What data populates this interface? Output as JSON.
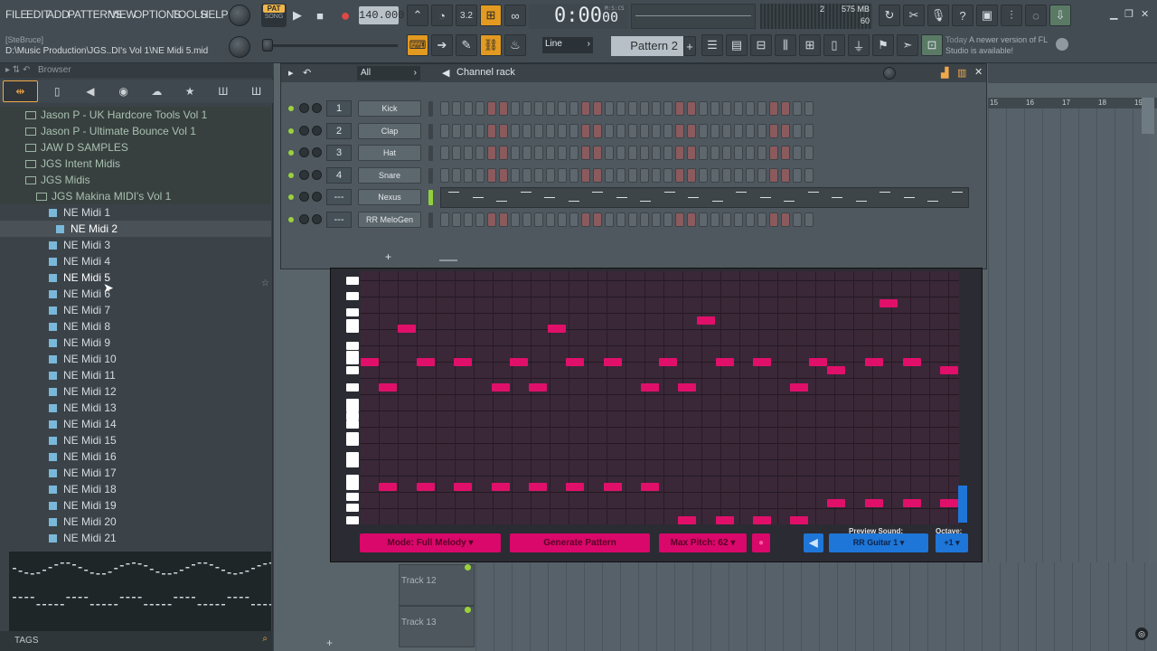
{
  "menu": [
    "FILE",
    "EDIT",
    "ADD",
    "PATTERNS",
    "VIEW",
    "OPTIONS",
    "TOOLS",
    "HELP"
  ],
  "transport": {
    "pat_label": "PAT",
    "song_label": "SONG",
    "tempo": "140.000",
    "time": "0:00",
    "time_frac": "00",
    "time_unit": "M:S:CS",
    "cpu": "575 MB",
    "poly": "60",
    "meter_val": "2"
  },
  "project": {
    "user": "[SteBruce]",
    "path": "D:\\Music Production\\JGS..DI's Vol 1\\NE Midi 5.mid"
  },
  "toolbar": {
    "snap": "Line",
    "pattern": "Pattern 2",
    "hint_day": "Today",
    "hint_text": "A newer version of FL Studio is available!"
  },
  "browser": {
    "title": "Browser",
    "folders": [
      "Jason P - UK Hardcore Tools Vol 1",
      "Jason P - Ultimate Bounce Vol 1",
      "JAW D SAMPLES",
      "JGS Intent Midis",
      "JGS Midis"
    ],
    "subfolder": "JGS Makina MIDI's Vol 1",
    "files": [
      "NE Midi 1",
      "NE Midi 2",
      "NE Midi 3",
      "NE Midi 4",
      "NE Midi 5",
      "NE Midi 6",
      "NE Midi 7",
      "NE Midi 8",
      "NE Midi 9",
      "NE Midi 10",
      "NE Midi 11",
      "NE Midi 12",
      "NE Midi 13",
      "NE Midi 14",
      "NE Midi 15",
      "NE Midi 16",
      "NE Midi 17",
      "NE Midi 18",
      "NE Midi 19",
      "NE Midi 20",
      "NE Midi 21"
    ],
    "tags_label": "TAGS"
  },
  "rack": {
    "title": "Channel rack",
    "filter": "All",
    "channels": [
      {
        "num": "1",
        "name": "Kick"
      },
      {
        "num": "2",
        "name": "Clap"
      },
      {
        "num": "3",
        "name": "Hat"
      },
      {
        "num": "4",
        "name": "Snare"
      },
      {
        "num": "---",
        "name": "Nexus"
      },
      {
        "num": "---",
        "name": "RR MeloGen"
      }
    ],
    "add_label": "+"
  },
  "plugin": {
    "mode": "Mode: Full Melody",
    "generate": "Generate Pattern",
    "max_pitch": "Max Pitch: 62",
    "preview_label": "Preview Sound:",
    "preview_value": "RR Guitar 1",
    "octave_label": "Octave:",
    "octave_value": "+1"
  },
  "playlist": {
    "ruler": [
      "15",
      "16",
      "17",
      "18",
      "19"
    ],
    "tracks": [
      "Track 12",
      "Track 13"
    ]
  },
  "colors": {
    "accent": "#f0a94a",
    "note": "#e0106a",
    "blue": "#1e76d8"
  }
}
